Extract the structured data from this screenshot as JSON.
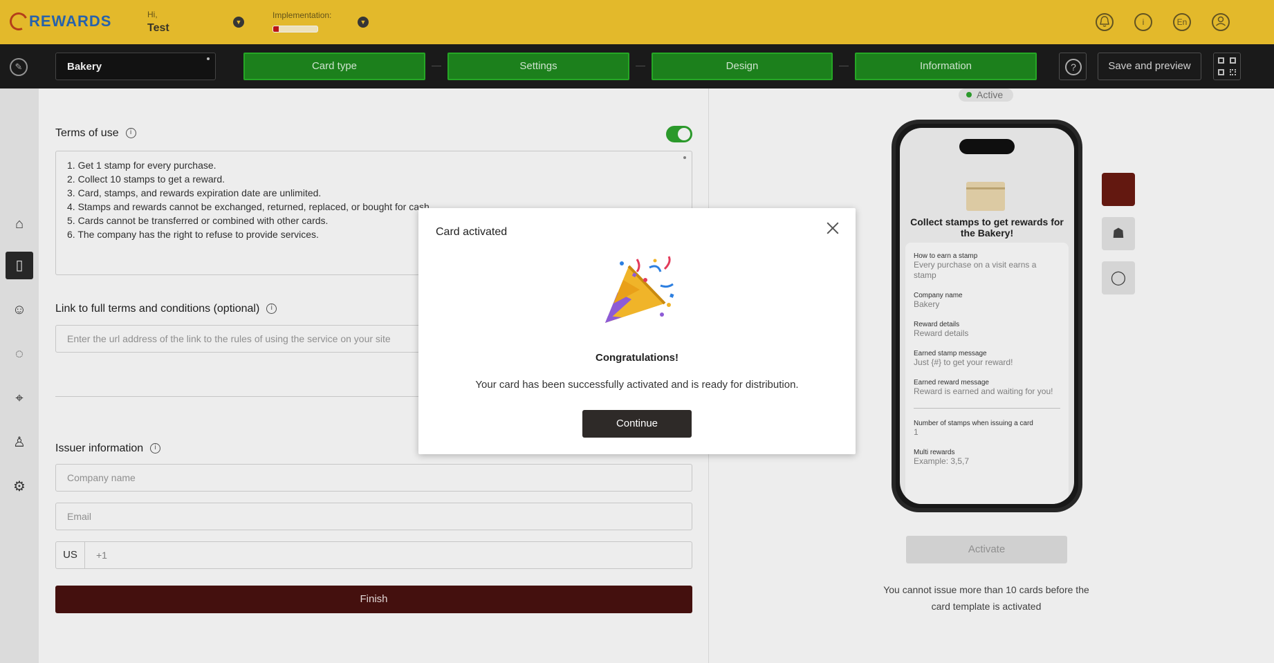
{
  "header": {
    "logo_text": "REWARDS",
    "greeting": "Hi,",
    "user_name": "Test",
    "implementation_label": "Implementation:",
    "implementation_progress": 0.12,
    "icons": [
      "bell-icon",
      "info-icon",
      "language-icon",
      "account-icon"
    ],
    "language_code": "En"
  },
  "toolbar": {
    "card_name": "Bakery",
    "steps": [
      "Card type",
      "Settings",
      "Design",
      "Information"
    ],
    "help_label": "?",
    "save_label": "Save and preview"
  },
  "sidebar": {
    "items": [
      "home-icon",
      "card-icon",
      "clients-icon",
      "messages-icon",
      "locations-icon",
      "managers-icon",
      "settings-icon"
    ],
    "active_index": 1
  },
  "form": {
    "terms_label": "Terms of use",
    "terms_enabled": true,
    "terms_lines": [
      "1. Get 1 stamp for every purchase.",
      "2. Collect 10 stamps to get a reward.",
      "3. Card, stamps, and rewards expiration date are unlimited.",
      "4. Stamps and rewards cannot be exchanged, returned, replaced, or bought for cash.",
      "5. Cards cannot be transferred or combined with other cards.",
      "6. The company has the right to refuse to provide services."
    ],
    "link_label": "Link to full terms and conditions (optional)",
    "link_placeholder": "Enter the url address of the link to the rules of using the service on your site",
    "issuer_label": "Issuer information",
    "company_placeholder": "Company name",
    "email_placeholder": "Email",
    "country_code": "US",
    "phone_prefix": "+1",
    "finish_label": "Finish"
  },
  "preview": {
    "status": "Active",
    "card_title": "Collect stamps to get rewards for the Bakery!",
    "fields": [
      {
        "key": "How to earn a stamp",
        "value": "Every purchase on a visit earns a stamp"
      },
      {
        "key": "Company name",
        "value": "Bakery"
      },
      {
        "key": "Reward details",
        "value": "Reward details"
      },
      {
        "key": "Earned stamp message",
        "value": "Just {#} to get your reward!"
      },
      {
        "key": "Earned reward message",
        "value": "Reward is earned and waiting for you!"
      }
    ],
    "fields_after": [
      {
        "key": "Number of stamps when issuing a card",
        "value": "1"
      },
      {
        "key": "Multi rewards",
        "value": "Example: 3,5,7"
      }
    ],
    "platforms": [
      "apple-icon",
      "android-icon",
      "chat-icon"
    ],
    "activate_label": "Activate",
    "notice": "You cannot issue more than 10 cards before the card template is activated"
  },
  "modal": {
    "title": "Card activated",
    "heading": "Congratulations!",
    "message": "Your card has been successfully activated and is ready for distribution.",
    "button": "Continue"
  }
}
